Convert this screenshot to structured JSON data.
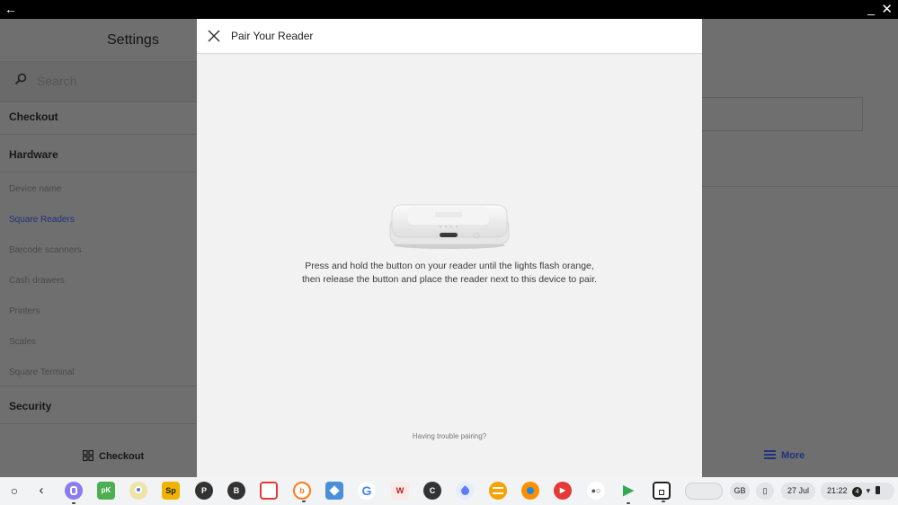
{
  "window": {
    "back_glyph": "←",
    "minimize_glyph": "_",
    "close_glyph": "✕"
  },
  "settings": {
    "title": "Settings",
    "search_placeholder": "Search",
    "sections": {
      "checkout": "Checkout",
      "hardware": "Hardware",
      "security": "Security"
    },
    "hardware_items": [
      "Device name",
      "Square Readers",
      "Barcode scanners",
      "Cash drawers",
      "Printers",
      "Scales",
      "Square Terminal"
    ],
    "active_item": "Square Readers"
  },
  "bottom_nav": {
    "checkout": "Checkout",
    "more": "More"
  },
  "modal": {
    "title": "Pair Your Reader",
    "instruction_line1": "Press and hold the button on your reader until the lights flash orange,",
    "instruction_line2": "then release the button and place the reader next to this device to pair.",
    "trouble_link": "Having trouble pairing?"
  },
  "taskbar": {
    "apps": [
      {
        "name": "launcher-icon",
        "glyph": "○",
        "color": "#f1f3f5"
      },
      {
        "name": "back-nav-icon",
        "glyph": "‹",
        "color": "#f1f3f5"
      },
      {
        "name": "app-icon-1",
        "glyph": "",
        "color": "#8a7cf0"
      },
      {
        "name": "app-icon-pk",
        "glyph": "pK",
        "color": "#4caf50"
      },
      {
        "name": "app-icon-chrome-canary",
        "glyph": "",
        "color": "#e0c060"
      },
      {
        "name": "app-icon-sp",
        "glyph": "Sp",
        "color": "#f0b400"
      },
      {
        "name": "app-icon-p",
        "glyph": "P",
        "color": "#333333"
      },
      {
        "name": "app-icon-b",
        "glyph": "B",
        "color": "#333333"
      },
      {
        "name": "app-icon-red-square",
        "glyph": "",
        "color": "#e53935"
      },
      {
        "name": "app-icon-b-orange",
        "glyph": "b",
        "color": "#ff7a1a"
      },
      {
        "name": "app-icon-photo",
        "glyph": "",
        "color": "#4a90d9"
      },
      {
        "name": "google-icon",
        "glyph": "G",
        "color": "#4285f4"
      },
      {
        "name": "app-icon-w",
        "glyph": "W",
        "color": "#b71c1c"
      },
      {
        "name": "app-icon-c",
        "glyph": "C",
        "color": "#333333"
      },
      {
        "name": "app-icon-drop",
        "glyph": "",
        "color": "#5c7cfa"
      },
      {
        "name": "app-icon-stack",
        "glyph": "",
        "color": "#f4a300"
      },
      {
        "name": "app-icon-orange-circle",
        "glyph": "",
        "color": "#ff8f00"
      },
      {
        "name": "youtube-music-icon",
        "glyph": "▶",
        "color": "#e53935"
      },
      {
        "name": "app-icon-dots",
        "glyph": "",
        "color": "#ffffff"
      },
      {
        "name": "play-store-icon",
        "glyph": "▶",
        "color": "#34a853"
      },
      {
        "name": "square-pos-icon",
        "glyph": "",
        "color": "#ffffff"
      }
    ],
    "tray": {
      "keyboard": "GB",
      "date": "27 Jul",
      "time": "21:22",
      "notifications": "4"
    }
  }
}
